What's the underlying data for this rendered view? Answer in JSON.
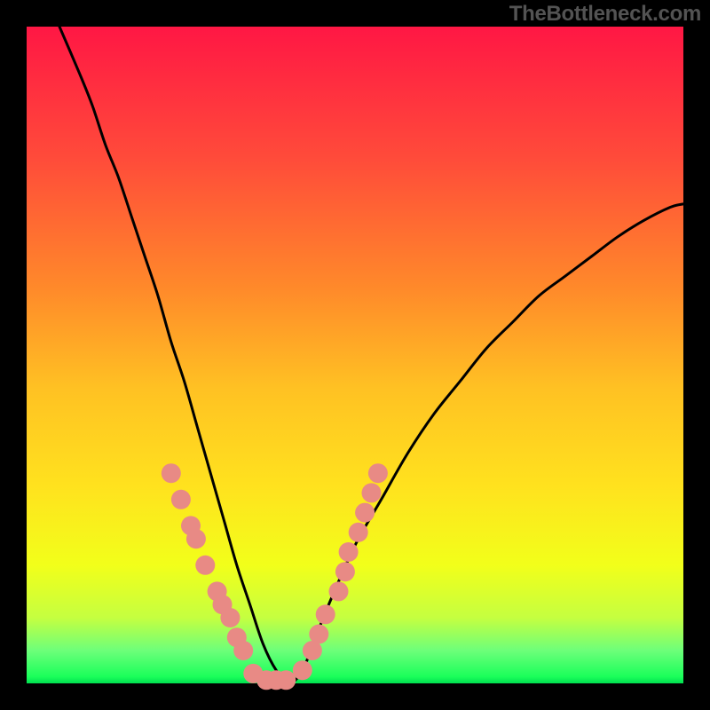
{
  "watermark": "TheBottleneck.com",
  "chart_data": {
    "type": "line",
    "title": "",
    "xlabel": "",
    "ylabel": "",
    "xlim": [
      0,
      100
    ],
    "ylim": [
      0,
      100
    ],
    "series": [
      {
        "name": "bottleneck-curve",
        "x": [
          5,
          8,
          10,
          12,
          14,
          16,
          18,
          20,
          22,
          24,
          26,
          28,
          30,
          32,
          34,
          36,
          38,
          40,
          42,
          44,
          46,
          50,
          54,
          58,
          62,
          66,
          70,
          74,
          78,
          82,
          86,
          90,
          94,
          98,
          100
        ],
        "values": [
          100,
          93,
          88,
          82,
          77,
          71,
          65,
          59,
          52,
          46,
          39,
          32,
          25,
          18,
          12,
          6,
          2,
          0,
          2,
          7,
          12,
          21,
          28,
          35,
          41,
          46,
          51,
          55,
          59,
          62,
          65,
          68,
          70.5,
          72.5,
          73
        ]
      }
    ],
    "markers": [
      {
        "x": 22,
        "y": 32,
        "color": "#e88a85"
      },
      {
        "x": 23.5,
        "y": 28,
        "color": "#e88a85"
      },
      {
        "x": 25,
        "y": 24,
        "color": "#e88a85"
      },
      {
        "x": 25.8,
        "y": 22,
        "color": "#e88a85"
      },
      {
        "x": 27.2,
        "y": 18,
        "color": "#e88a85"
      },
      {
        "x": 29,
        "y": 14,
        "color": "#e88a85"
      },
      {
        "x": 29.8,
        "y": 12,
        "color": "#e88a85"
      },
      {
        "x": 31,
        "y": 10,
        "color": "#e88a85"
      },
      {
        "x": 32,
        "y": 7,
        "color": "#e88a85"
      },
      {
        "x": 33,
        "y": 5,
        "color": "#e88a85"
      },
      {
        "x": 34.5,
        "y": 1.5,
        "color": "#e88a85"
      },
      {
        "x": 36.5,
        "y": 0.5,
        "color": "#e88a85"
      },
      {
        "x": 38,
        "y": 0.5,
        "color": "#e88a85"
      },
      {
        "x": 39.5,
        "y": 0.5,
        "color": "#e88a85"
      },
      {
        "x": 42,
        "y": 2,
        "color": "#e88a85"
      },
      {
        "x": 43.5,
        "y": 5,
        "color": "#e88a85"
      },
      {
        "x": 44.5,
        "y": 7.5,
        "color": "#e88a85"
      },
      {
        "x": 45.5,
        "y": 10.5,
        "color": "#e88a85"
      },
      {
        "x": 47.5,
        "y": 14,
        "color": "#e88a85"
      },
      {
        "x": 48.5,
        "y": 17,
        "color": "#e88a85"
      },
      {
        "x": 49,
        "y": 20,
        "color": "#e88a85"
      },
      {
        "x": 50.5,
        "y": 23,
        "color": "#e88a85"
      },
      {
        "x": 51.5,
        "y": 26,
        "color": "#e88a85"
      },
      {
        "x": 52.5,
        "y": 29,
        "color": "#e88a85"
      },
      {
        "x": 53.5,
        "y": 32,
        "color": "#e88a85"
      }
    ],
    "gradient_stops": [
      {
        "offset": 0,
        "color": "#ff1744"
      },
      {
        "offset": 20,
        "color": "#ff4b3a"
      },
      {
        "offset": 40,
        "color": "#ff8a2a"
      },
      {
        "offset": 55,
        "color": "#ffc123"
      },
      {
        "offset": 70,
        "color": "#ffe21e"
      },
      {
        "offset": 82,
        "color": "#f2ff1a"
      },
      {
        "offset": 90,
        "color": "#c5ff40"
      },
      {
        "offset": 95,
        "color": "#6dff7a"
      },
      {
        "offset": 99,
        "color": "#1aff5a"
      },
      {
        "offset": 100,
        "color": "#00e050"
      }
    ]
  }
}
